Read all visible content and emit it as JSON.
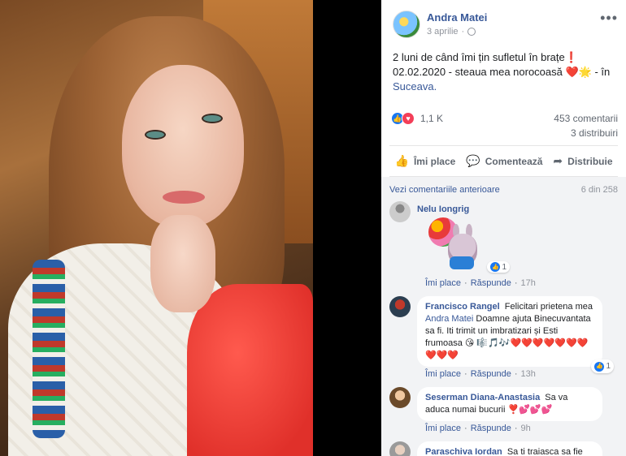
{
  "post": {
    "author": "Andra Matei",
    "date": "3 aprilie",
    "privacy_icon": "globe-icon",
    "more_label": "•••",
    "text_main": "2 luni de când îmi țin sufletul în brațe❗ 02.02.2020 - steaua mea norocoasă ❤️🌟",
    "text_loc_prefix": " - în ",
    "text_loc": "Suceava.",
    "reaction_count": "1,1 K",
    "comments_count": "453 comentarii",
    "shares_count": "3 distribuiri"
  },
  "actions": {
    "like": "Îmi place",
    "comment": "Comentează",
    "share": "Distribuie"
  },
  "comments_header": {
    "prev_link": "Vezi comentariile anterioare",
    "count": "6 din 258"
  },
  "comments": [
    {
      "name": "Nelu Iongrig",
      "text": "",
      "like_label": "Îmi place",
      "reply_label": "Răspunde",
      "time": "17h",
      "reactions": "1"
    },
    {
      "name": "Francisco Rangel",
      "text_before": "Felicitari prietena mea",
      "mention": "Andra Matei",
      "text_after": "Doamne ajuta Binecuvantata sa fi. Iti trimit un imbratizari și Esti frumoasa 😘 🎼🎵🎶❤️❤️❤️❤️❤️❤️❤️❤️❤️❤️",
      "like_label": "Îmi place",
      "reply_label": "Răspunde",
      "time": "13h",
      "reactions": "1"
    },
    {
      "name": "Seserman Diana-Anastasia",
      "text": "Sa va aduca numai bucurii ❣️💕💕💕",
      "like_label": "Îmi place",
      "reply_label": "Răspunde",
      "time": "9h"
    },
    {
      "name": "Paraschiva Iordan",
      "text": "Sa ti traiasca sa fie sanatos ,o viata cat mai lunga!"
    }
  ],
  "colors": {
    "link": "#385898",
    "like_blue": "#1877f2",
    "love_red": "#f33e58",
    "comment_bg": "#f2f3f5"
  }
}
